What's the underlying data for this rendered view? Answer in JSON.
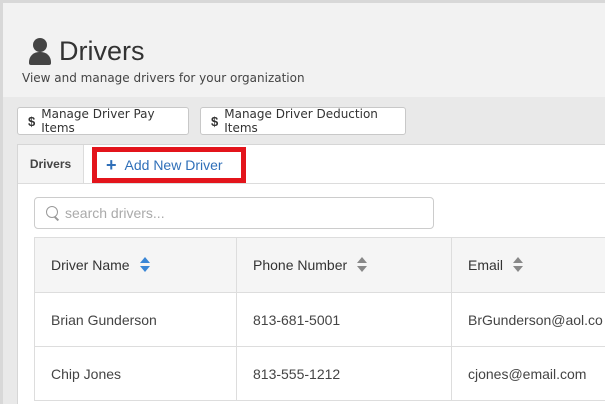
{
  "header": {
    "title": "Drivers",
    "subtitle": "View and manage drivers for your organization",
    "user_icon": "user-icon"
  },
  "toolbar": {
    "pay_items_label": "Manage Driver Pay Items",
    "deduction_items_label": "Manage Driver Deduction Items",
    "dollar_symbol": "$"
  },
  "tabs": {
    "drivers_label": "Drivers",
    "add_new_label": "Add New Driver",
    "add_new_icon": "+"
  },
  "search": {
    "placeholder": "search drivers...",
    "value": ""
  },
  "table": {
    "columns": [
      "Driver Name",
      "Phone Number",
      "Email"
    ],
    "rows": [
      [
        "Brian Gunderson",
        "813-681-5001",
        "BrGunderson@aol.co"
      ],
      [
        "Chip Jones",
        "813-555-1212",
        "cjones@email.com"
      ]
    ]
  },
  "colors": {
    "accent_blue": "#2f6fb8",
    "highlight_red": "#e3141b",
    "sort_active": "#3a86d6"
  }
}
